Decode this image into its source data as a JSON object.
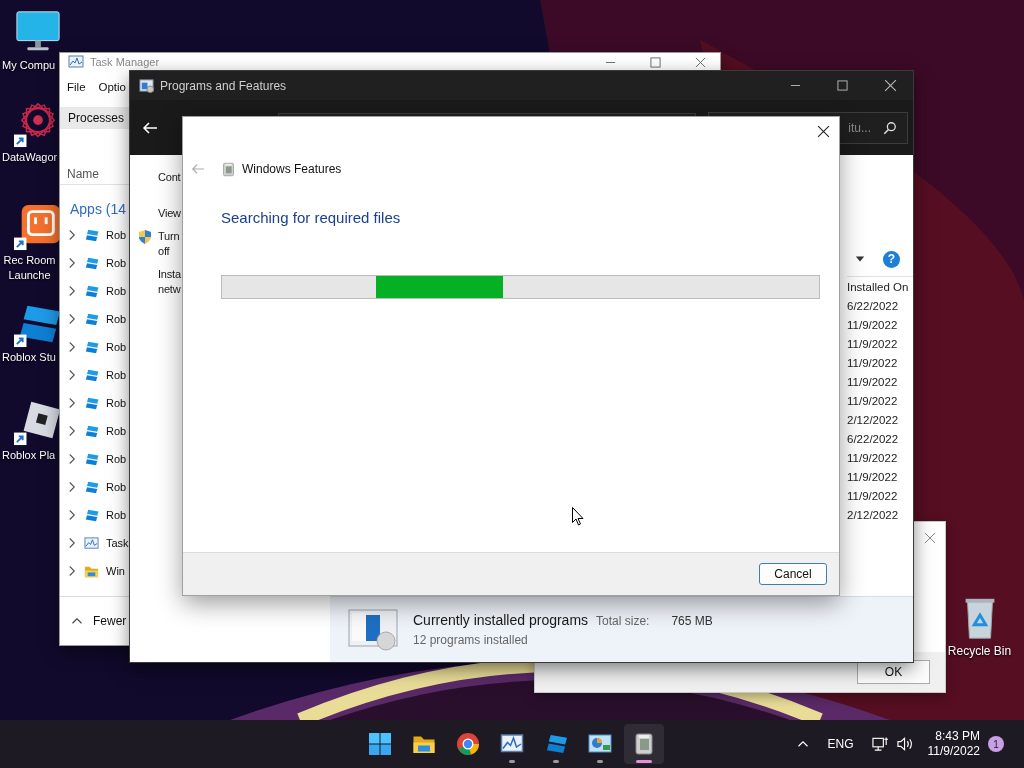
{
  "desktop_icons": [
    {
      "label": "My Compu",
      "kind": "monitor"
    },
    {
      "label": "DataWagor",
      "kind": "star"
    },
    {
      "label": "Rec Room Launche",
      "kind": "smiley"
    },
    {
      "label": "Roblox Stu",
      "kind": "studio"
    },
    {
      "label": "Roblox Pla",
      "kind": "player"
    },
    {
      "label": "Recycle Bin",
      "kind": "recycle"
    }
  ],
  "task_manager": {
    "title": "Task Manager",
    "menu": [
      "File",
      "Optio"
    ],
    "tabs": [
      {
        "label": "Processes",
        "selected": true
      }
    ],
    "column": "Name",
    "group": "Apps (14",
    "rows": [
      {
        "label": "Rob",
        "kind": "studio"
      },
      {
        "label": "Rob",
        "kind": "studio"
      },
      {
        "label": "Rob",
        "kind": "studio"
      },
      {
        "label": "Rob",
        "kind": "studio"
      },
      {
        "label": "Rob",
        "kind": "studio"
      },
      {
        "label": "Rob",
        "kind": "studio"
      },
      {
        "label": "Rob",
        "kind": "studio"
      },
      {
        "label": "Rob",
        "kind": "studio"
      },
      {
        "label": "Rob",
        "kind": "studio"
      },
      {
        "label": "Rob",
        "kind": "studio"
      },
      {
        "label": "Rob",
        "kind": "studio"
      },
      {
        "label": "Task",
        "kind": "chart"
      },
      {
        "label": "Win",
        "kind": "folder"
      }
    ],
    "footer": "Fewer"
  },
  "programs_and_features": {
    "title": "Programs and Features",
    "search_text": "itu...",
    "help": "?",
    "links": [
      {
        "text": "Cont",
        "kind": "plain"
      },
      {
        "text": "View",
        "kind": "plain"
      },
      {
        "text": "Turn off",
        "kind": "shield"
      },
      {
        "text": "Insta netw",
        "kind": "plain"
      }
    ],
    "column": "Installed On",
    "dates": [
      "6/22/2022",
      "11/9/2022",
      "11/9/2022",
      "11/9/2022",
      "11/9/2022",
      "11/9/2022",
      "2/12/2022",
      "6/22/2022",
      "11/9/2022",
      "11/9/2022",
      "11/9/2022",
      "2/12/2022"
    ],
    "details": {
      "title": "Currently installed programs",
      "size_label": "Total size:",
      "size": "765 MB",
      "count": "12 programs installed"
    }
  },
  "message_box": {
    "button": "OK"
  },
  "windows_features": {
    "title": "Windows Features",
    "heading": "Searching for required files",
    "progress": {
      "indeterminate": true
    },
    "button": "Cancel"
  },
  "taskbar": {
    "apps": [
      {
        "kind": "start",
        "running": false,
        "selected": false
      },
      {
        "kind": "folder",
        "running": false,
        "selected": false
      },
      {
        "kind": "browser",
        "running": false,
        "selected": false
      },
      {
        "kind": "chart",
        "running": true,
        "selected": false
      },
      {
        "kind": "studio",
        "running": true,
        "selected": false
      },
      {
        "kind": "control",
        "running": true,
        "selected": false
      },
      {
        "kind": "box",
        "running": true,
        "selected": true
      }
    ],
    "language": "ENG",
    "time": "8:43 PM",
    "date": "11/9/2022",
    "notifications": "1"
  }
}
